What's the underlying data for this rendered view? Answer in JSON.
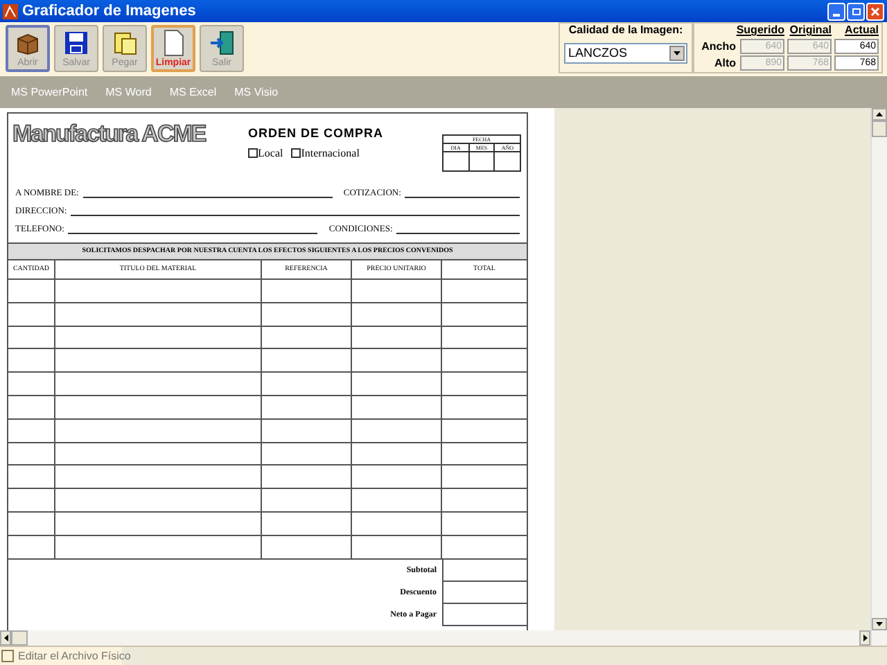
{
  "window": {
    "title": "Graficador de Imagenes"
  },
  "toolbar": [
    {
      "label": "Abrir",
      "kind": "open",
      "selected": true,
      "highlighted": false
    },
    {
      "label": "Salvar",
      "kind": "save",
      "selected": false,
      "highlighted": false
    },
    {
      "label": "Pegar",
      "kind": "paste",
      "selected": false,
      "highlighted": false
    },
    {
      "label": "Limpiar",
      "kind": "clear",
      "selected": false,
      "highlighted": true
    },
    {
      "label": "Salir",
      "kind": "exit",
      "selected": false,
      "highlighted": false
    }
  ],
  "quality": {
    "label": "Calidad de la Imagen:",
    "value": "LANCZOS"
  },
  "size": {
    "row_labels": [
      "Ancho",
      "Alto"
    ],
    "columns": [
      {
        "heading": "Sugerido",
        "disabled": true,
        "values": [
          "640",
          "890"
        ]
      },
      {
        "heading": "Original",
        "disabled": true,
        "values": [
          "640",
          "768"
        ]
      },
      {
        "heading": "Actual",
        "disabled": false,
        "values": [
          "640",
          "768"
        ]
      }
    ]
  },
  "menu": [
    "MS PowerPoint",
    "MS Word",
    "MS Excel",
    "MS Visio"
  ],
  "document": {
    "logo": "Manufactura ACME",
    "heading": "ORDEN DE COMPRA",
    "options": [
      {
        "label": "Local",
        "checked": false
      },
      {
        "label": "Internacional",
        "checked": false
      }
    ],
    "date": {
      "title": "FECHA",
      "parts": [
        "DIA",
        "MES",
        "AÑO"
      ]
    },
    "fields": [
      [
        "A NOMBRE DE:",
        "COTIZACION:"
      ],
      [
        "DIRECCION:"
      ],
      [
        "TELEFONO:",
        "CONDICIONES:"
      ]
    ],
    "banner": "SOLICITAMOS DESPACHAR POR NUESTRA CUENTA LOS EFECTOS SIGUIENTES A LOS PRECIOS CONVENIDOS",
    "columns": [
      "CANTIDAD",
      "TITULO DEL MATERIAL",
      "REFERENCIA",
      "PRECIO UNITARIO",
      "TOTAL"
    ],
    "totals": [
      "Subtotal",
      "Descuento",
      "Neto a Pagar"
    ]
  },
  "status_bar": {
    "label": "Editar el Archivo Físico",
    "checked": false
  }
}
